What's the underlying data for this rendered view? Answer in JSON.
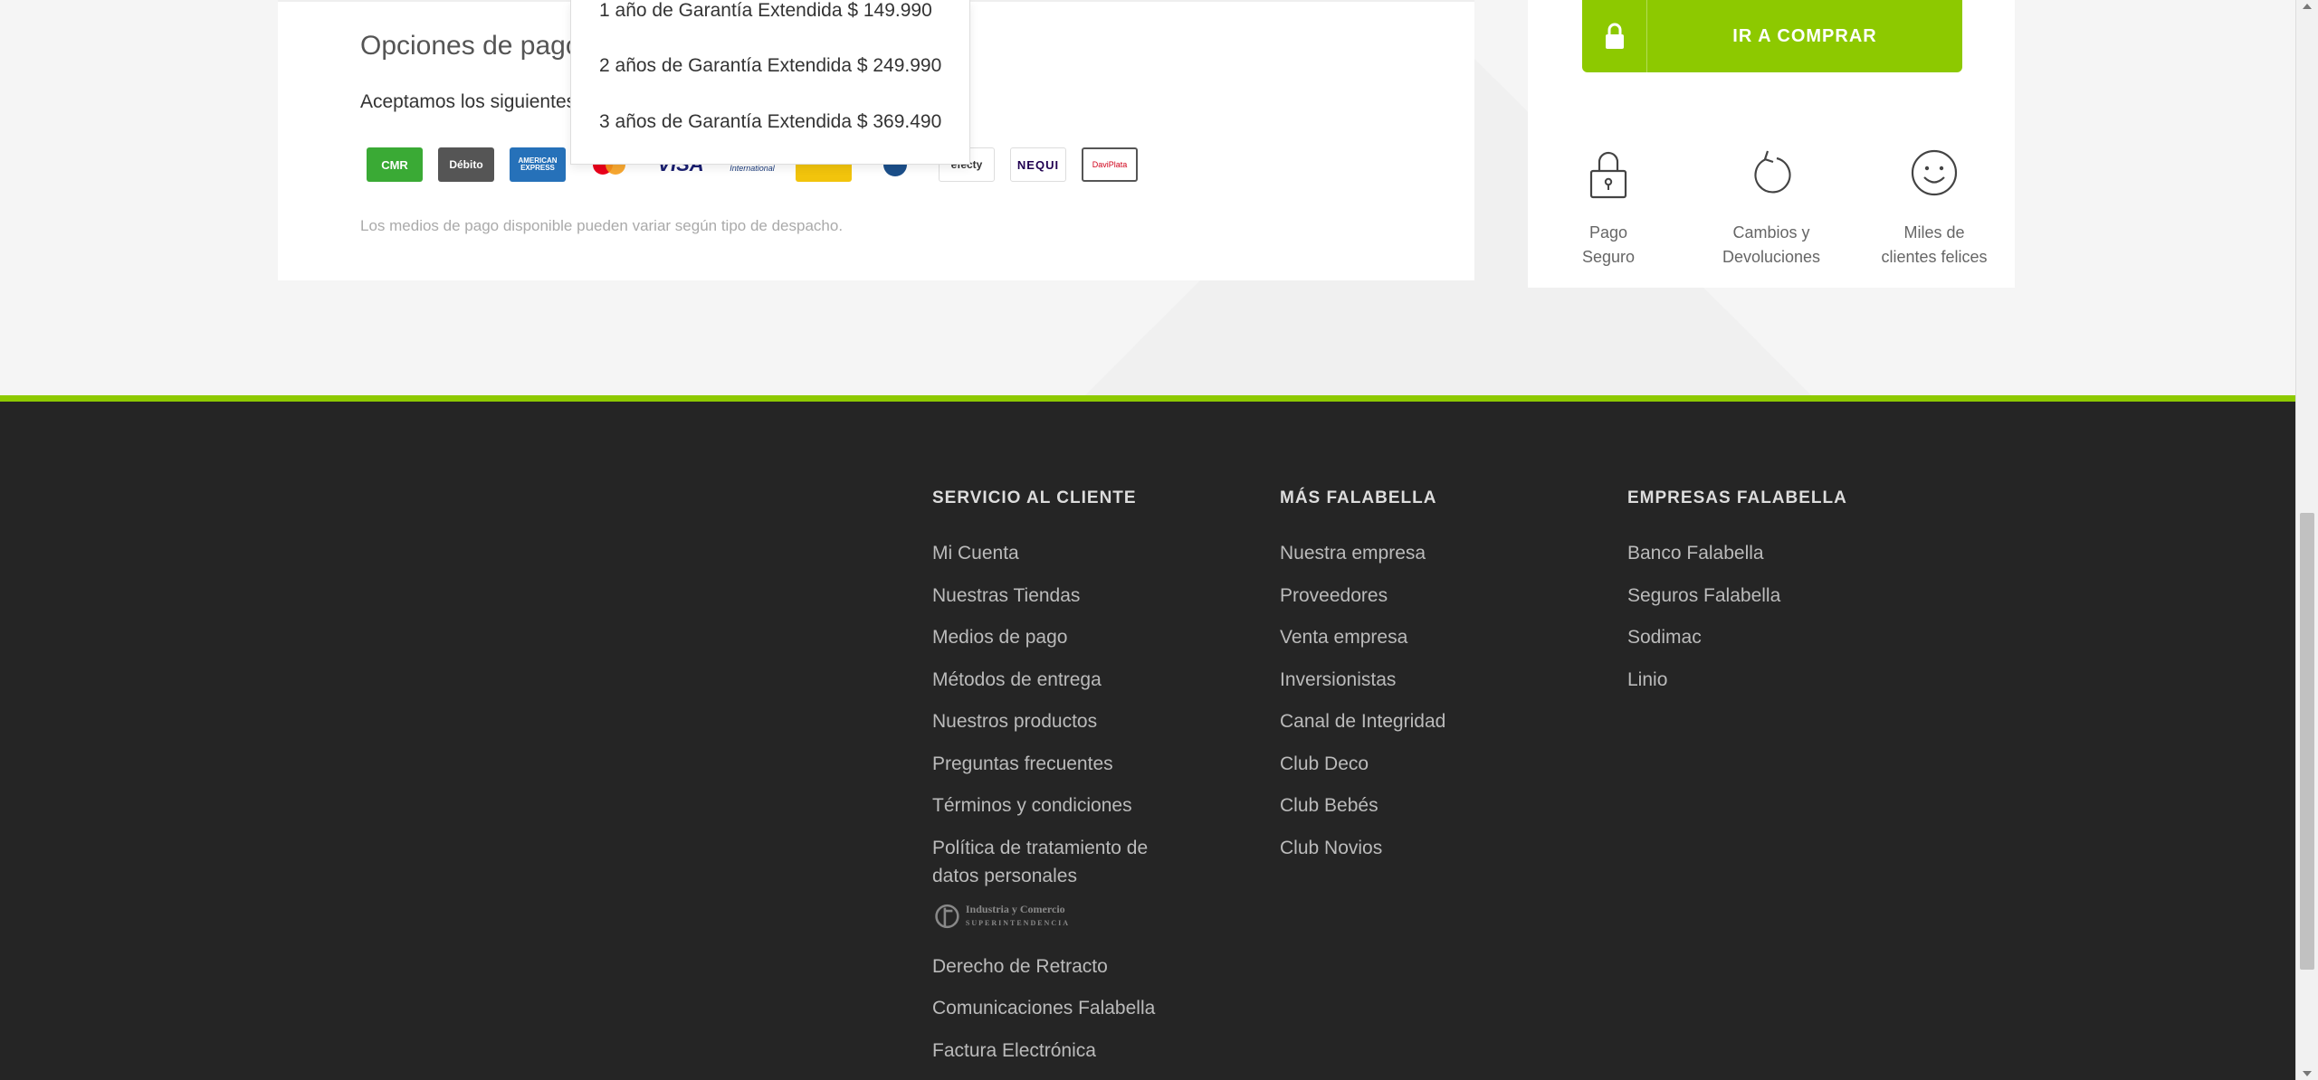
{
  "payment": {
    "title": "Opciones de pago",
    "subtitle": "Aceptamos los siguientes",
    "note": "Los medios de pago disponible pueden variar según tipo de despacho.",
    "logos": [
      {
        "name": "cmr-falabella",
        "text": "CMR"
      },
      {
        "name": "debito-falabella",
        "text": "Débito"
      },
      {
        "name": "american-express",
        "text": "AMERICAN EXPRESS"
      },
      {
        "name": "mastercard",
        "text": ""
      },
      {
        "name": "visa",
        "text": "VISA"
      },
      {
        "name": "diners-club",
        "text": "Diners Club International"
      },
      {
        "name": "bancolombia",
        "text": ""
      },
      {
        "name": "pse",
        "text": ""
      },
      {
        "name": "efecty",
        "text": "efecty"
      },
      {
        "name": "nequi",
        "text": "NEQUI"
      },
      {
        "name": "daviplata",
        "text": "DaviPlata"
      }
    ]
  },
  "warranty_dropdown": {
    "options": [
      "1 año de Garantía Extendida $ 149.990",
      "2 años de Garantía Extendida $ 249.990",
      "3 años de Garantía Extendida $ 369.490"
    ]
  },
  "purchase": {
    "button_label": "IR A COMPRAR",
    "accent_color": "#8dc900",
    "features": [
      {
        "icon": "lock-icon",
        "line1": "Pago",
        "line2": "Seguro"
      },
      {
        "icon": "refresh-icon",
        "line1": "Cambios y",
        "line2": "Devoluciones"
      },
      {
        "icon": "smile-icon",
        "line1": "Miles de",
        "line2": "clientes felices"
      }
    ]
  },
  "footer": {
    "background": "#252525",
    "servicio": {
      "heading": "SERVICIO AL CLIENTE",
      "links": [
        "Mi Cuenta",
        "Nuestras Tiendas",
        "Medios de pago",
        "Métodos de entrega",
        "Nuestros productos",
        "Preguntas frecuentes",
        "Términos y condiciones",
        "Política de tratamiento de datos personales"
      ],
      "sic_logo_text": "Industria y Comercio",
      "sic_logo_subtext": "SUPERINTENDENCIA",
      "links_after": [
        "Derecho de Retracto",
        "Comunicaciones Falabella",
        "Factura Electrónica"
      ]
    },
    "mas": {
      "heading": "MÁS FALABELLA",
      "links": [
        "Nuestra empresa",
        "Proveedores",
        "Venta empresa",
        "Inversionistas",
        "Canal de Integridad",
        "Club Deco",
        "Club Bebés",
        "Club Novios"
      ]
    },
    "empresas": {
      "heading": "EMPRESAS FALABELLA",
      "links": [
        "Banco Falabella",
        "Seguros Falabella",
        "Sodimac",
        "Linio"
      ]
    }
  }
}
